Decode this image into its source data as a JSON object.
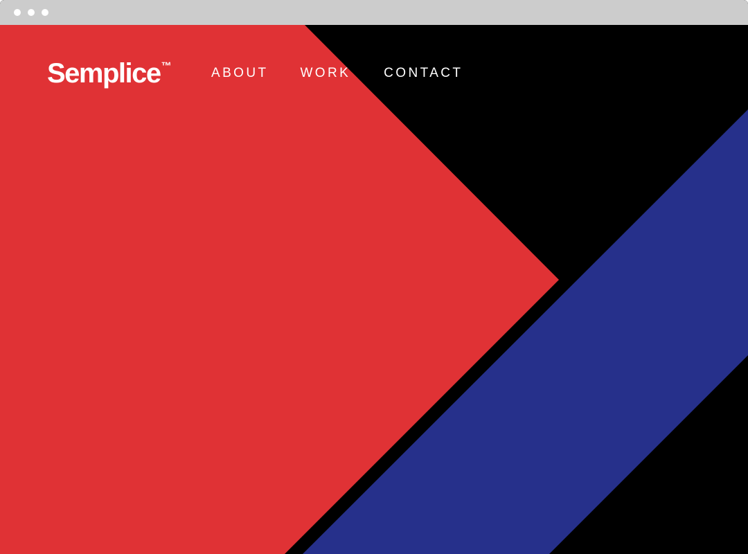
{
  "window": {
    "dots": [
      "dot",
      "dot",
      "dot"
    ]
  },
  "brand": {
    "name": "Semplice",
    "trademark": "™"
  },
  "nav": {
    "items": [
      {
        "label": "ABOUT"
      },
      {
        "label": "WORK"
      },
      {
        "label": "CONTACT"
      }
    ]
  },
  "colors": {
    "background": "#000000",
    "red_shape": "#e03235",
    "blue_band": "#26308b",
    "text": "#ffffff",
    "title_bar": "#cccccc"
  }
}
